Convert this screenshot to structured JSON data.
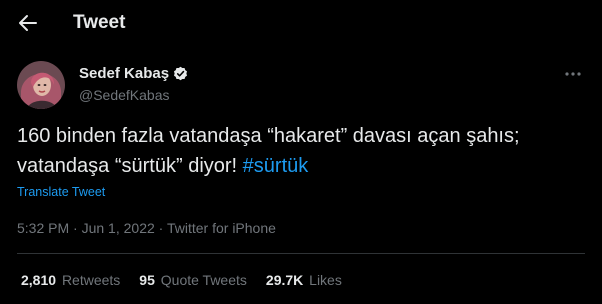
{
  "header": {
    "title": "Tweet",
    "back_icon": "arrow-left-icon"
  },
  "author": {
    "name": "Sedef Kabaş",
    "handle": "@SedefKabas",
    "verified_icon": "verified-badge-icon"
  },
  "tweet": {
    "text": "160 binden fazla vatandaşa “hakaret” davası açan şahıs; vatandaşa “sürtük” diyor! ",
    "hashtag": "#sürtük",
    "translate_label": "Translate Tweet",
    "time": "5:32 PM",
    "separator": " · ",
    "date": "Jun 1, 2022",
    "source": "Twitter for iPhone"
  },
  "stats": [
    {
      "count": "2,810",
      "label": "Retweets"
    },
    {
      "count": "95",
      "label": "Quote Tweets"
    },
    {
      "count": "29.7K",
      "label": "Likes"
    }
  ],
  "colors": {
    "background": "#000000",
    "text": "#e7e9ea",
    "secondary": "#71767b",
    "accent": "#1d9bf0",
    "divider": "#2f3336"
  }
}
